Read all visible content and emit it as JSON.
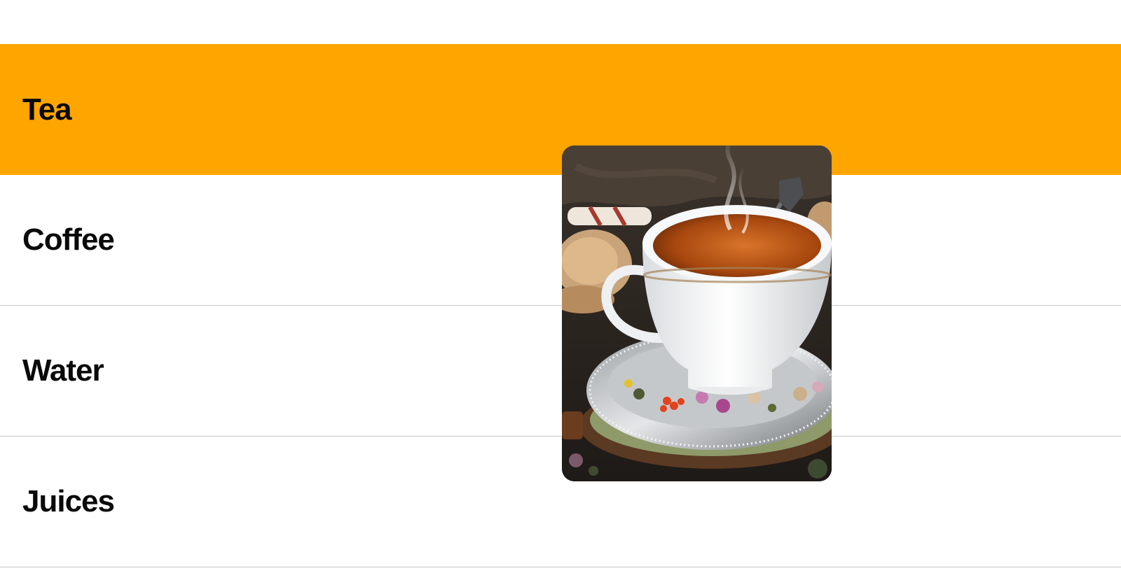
{
  "menu": {
    "items": [
      {
        "label": "Tea",
        "active": true
      },
      {
        "label": "Coffee",
        "active": false
      },
      {
        "label": "Water",
        "active": false
      },
      {
        "label": "Juices",
        "active": false
      }
    ]
  },
  "preview": {
    "subject": "cup-of-tea-photo"
  },
  "colors": {
    "active_background": "#FFA500",
    "text": "#0a0a0a",
    "divider": "#c9c9c9",
    "background": "#ffffff"
  }
}
